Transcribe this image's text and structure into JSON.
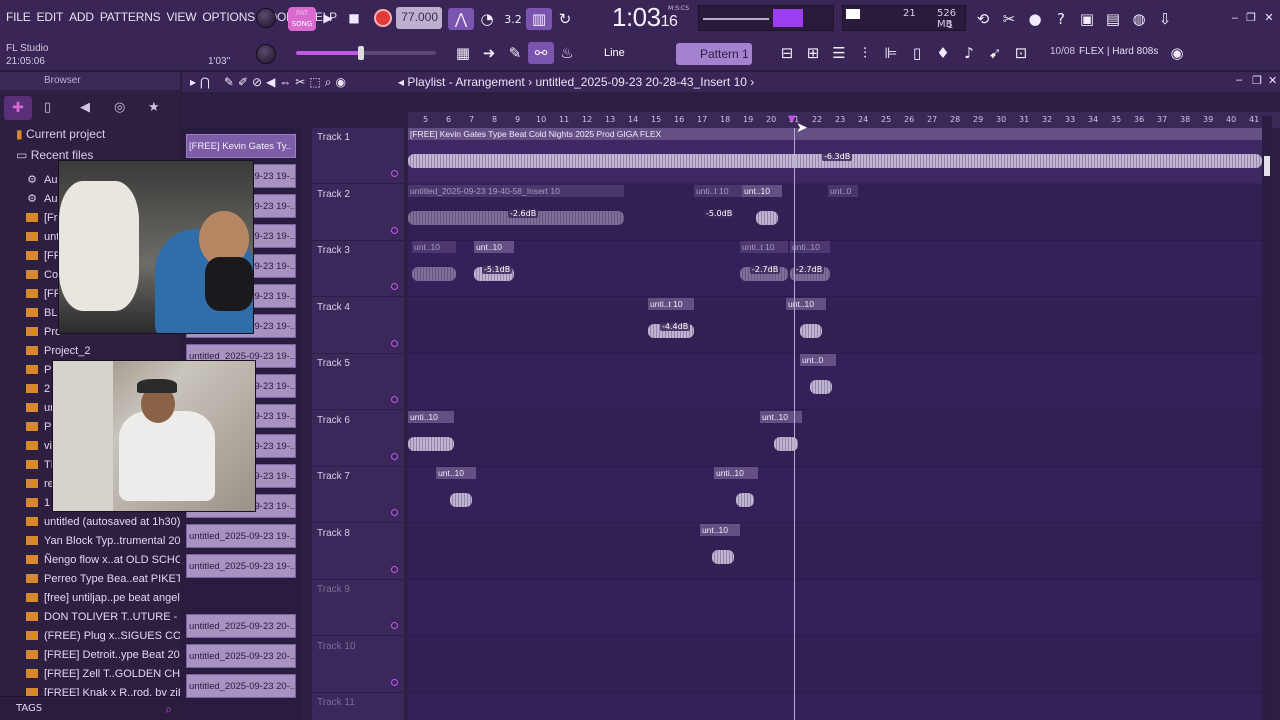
{
  "menu": [
    "FILE",
    "EDIT",
    "ADD",
    "PATTERNS",
    "VIEW",
    "OPTIONS",
    "TOOLS",
    "HELP"
  ],
  "app": {
    "name": "FL Studio",
    "clock": "21:05:06",
    "hint_time": "1'03''"
  },
  "transport": {
    "pat_label": "PAT",
    "song_label": "SONG",
    "tempo": "77.000",
    "time_main": "1:03",
    "time_sub": "16",
    "time_unit": "M:S:CS",
    "counter": "3.2"
  },
  "cpu": {
    "val1": "21",
    "mem": "526 MB",
    "val3": "1"
  },
  "toolbar": {
    "snap": "Line",
    "pattern": "Pattern 1",
    "hint_count": "10/08",
    "hint_text": "FLEX | Hard 808s"
  },
  "browser": {
    "title": "Browser",
    "current_project": "Current project",
    "recent_files": "Recent files",
    "items_upper": [
      "Au",
      "Au",
      "[Fr",
      "unt",
      "[FR",
      "Co",
      "[FF",
      "BLO",
      "Pro",
      "Project_2",
      "Pr",
      "2",
      "un",
      "Pr",
      "vi",
      "TF",
      "re",
      "1"
    ],
    "items": [
      "untitled (autosaved at 1h30)",
      "Yan Block Typ..trumental 2025",
      "Ñengo flow x..at OLD SCHOOL",
      "Perreo Type Bea..eat PIKETUA",
      "[free] untiljap..pe beat angels",
      "DON TOLIVER T..UTURE - AREA",
      "(FREE) Plug x..SIGUES CON EL",
      "[FREE] Detroit..ype Beat 2025",
      "[FREE] Zell T..GOLDEN CHAINS",
      "[FREE] Knak x R..rod. by ziLen"
    ],
    "tags": "TAGS"
  },
  "playlist": {
    "title": "Playlist - Arrangement",
    "project": "untitled_2025-09-23 20-28-43_Insert 10",
    "patterns": [
      "[FREE] Kevin Gates Ty..",
      "untitled_2025-09-23 19-..",
      "untitled_2025-09-23 19-..",
      "untitled_2025-09-23 19-..",
      "untitled_2025-09-23 19-..",
      "untitled_2025-09-23 19-..",
      "untitled_2025-09-23 19-..",
      "untitled_2025-09-23 19-..",
      "untitled_2025-09-23 19-..",
      "untitled_2025-09-23 19-..",
      "untitled_2025-09-23 19-..",
      "untitled_2025-09-23 19-..",
      "untitled_2025-09-23 19-..",
      "untitled_2025-09-23 19-..",
      "untitled_2025-09-23 19-..",
      "untitled_2025-09-23 20-..",
      "untitled_2025-09-23 20-..",
      "untitled_2025-09-23 20-.."
    ],
    "tracks": [
      "Track 1",
      "Track 2",
      "Track 3",
      "Track 4",
      "Track 5",
      "Track 6",
      "Track 7",
      "Track 8",
      "Track 9",
      "Track 10",
      "Track 11"
    ],
    "ruler": [
      "5",
      "6",
      "7",
      "8",
      "9",
      "10",
      "11",
      "12",
      "13",
      "14",
      "15",
      "16",
      "17",
      "18",
      "19",
      "20",
      "21",
      "22",
      "23",
      "24",
      "25",
      "26",
      "27",
      "28",
      "29",
      "30",
      "31",
      "32",
      "33",
      "34",
      "35",
      "36",
      "37",
      "38",
      "39",
      "40",
      "41"
    ],
    "clips": {
      "main": "[FREE] Kevin Gates Type Beat  Cold Nights  2025  Prod GIGA FLEX",
      "main_db": "-6.3dB",
      "t2a": "untitled_2025-09-23 19-40-58_Insert 10",
      "t2a_db": "-2.6dB",
      "t2b": "unti..t 10",
      "t2c": "unt..10",
      "t2b_db": "-5.0dB",
      "t2d": "unt..0",
      "t3a": "unt..10",
      "t3b": "unt..10",
      "t3b_db": "-5.1dB",
      "t3c": "unti..t 10",
      "t3d": "unti..10",
      "t3c_db": "-2.7dB",
      "t3d_db": "-2.7dB",
      "t4a": "unti..t 10",
      "t4a_db": "-4.4dB",
      "t4b": "unt..10",
      "t5a": "unt..0",
      "t6a": "unti..10",
      "t6b": "unt..10",
      "t7a": "unt..10",
      "t7b": "unti..10",
      "t8a": "unt..10"
    }
  }
}
